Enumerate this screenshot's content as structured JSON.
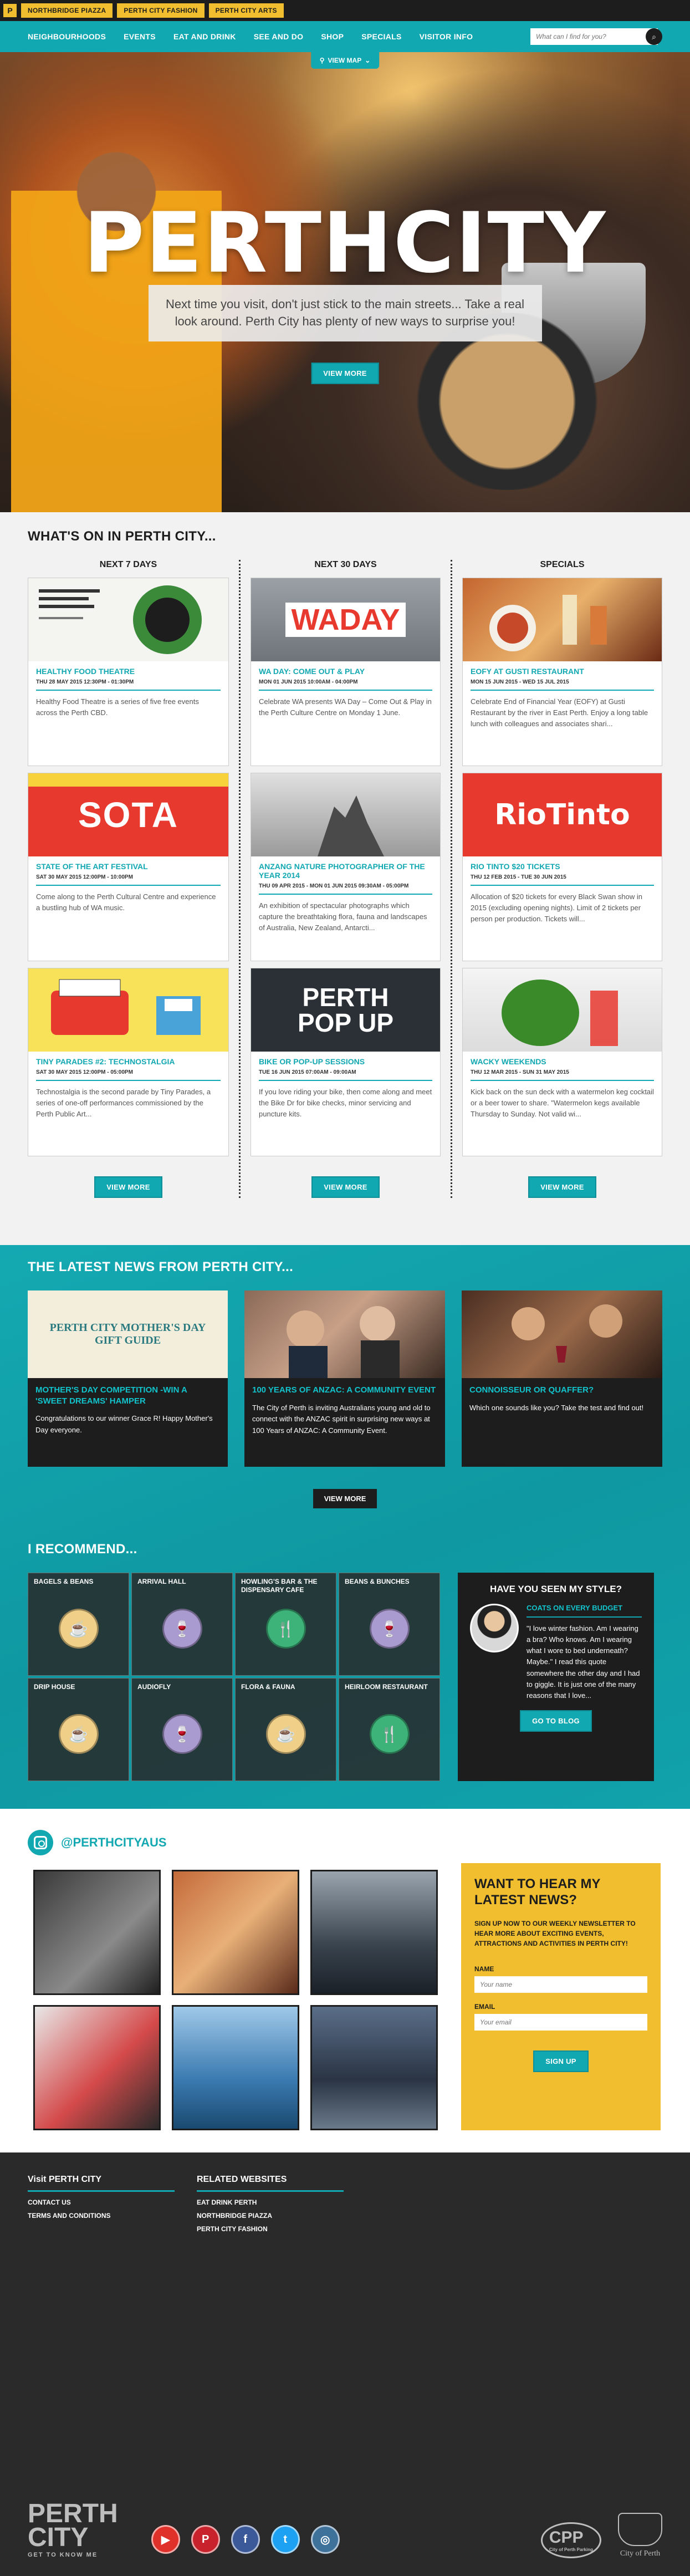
{
  "topbar": {
    "logo_letter": "P",
    "links": [
      "NORTHBRIDGE PIAZZA",
      "PERTH CITY FASHION",
      "PERTH CITY ARTS"
    ]
  },
  "nav": {
    "items": [
      "NEIGHBOURHOODS",
      "EVENTS",
      "EAT AND DRINK",
      "SEE AND DO",
      "SHOP",
      "SPECIALS",
      "VISITOR INFO"
    ],
    "search_placeholder": "What can I find for you?"
  },
  "hero": {
    "map_button": "VIEW MAP",
    "brand": "PERTHCITY",
    "tagline": "Next time you visit, don't just stick to the main streets... Take a real look around. Perth City has plenty of new ways to surprise you!",
    "view_more": "VIEW MORE"
  },
  "whats_on": {
    "title": "WHAT'S ON IN PERTH CITY...",
    "columns": [
      {
        "heading": "NEXT 7 DAYS",
        "cards": [
          {
            "title": "HEALTHY FOOD THEATRE",
            "date": "THU 28 MAY 2015 12:30PM - 01:30PM",
            "desc": "Healthy Food Theatre is a series of five free events across the Perth CBD.",
            "thumb_bg": "#f4f4f0",
            "thumb_label": ""
          },
          {
            "title": "STATE OF THE ART FESTIVAL",
            "date": "SAT 30 MAY 2015 12:00PM - 10:00PM",
            "desc": "Come along to the Perth Cultural Centre and experience a bustling hub of WA music.",
            "thumb_bg": "#e8392f",
            "thumb_label": "SOTA"
          },
          {
            "title": "TINY PARADES #2: TECHNOSTALGIA",
            "date": "SAT 30 MAY 2015 12:00PM - 05:00PM",
            "desc": "Technostalgia is the second parade by Tiny Parades, a series of one-off performances commissioned by the Perth Public Art...",
            "thumb_bg": "#f7e25a",
            "thumb_label": ""
          }
        ],
        "more": "VIEW MORE"
      },
      {
        "heading": "NEXT 30 DAYS",
        "cards": [
          {
            "title": "WA DAY: COME OUT & PLAY",
            "date": "MON 01 JUN 2015 10:00AM - 04:00PM",
            "desc": "Celebrate WA presents WA Day – Come Out & Play in the Perth Culture Centre on Monday 1 June.",
            "thumb_bg": "#8a8f95",
            "thumb_label": "WADAY"
          },
          {
            "title": "ANZANG NATURE PHOTOGRAPHER OF THE YEAR 2014",
            "date": "THU 09 APR 2015 - MON 01 JUN 2015 09:30AM - 05:00PM",
            "desc": "An exhibition of spectacular photographs which capture the breathtaking flora, fauna and landscapes of Australia, New Zealand, Antarcti...",
            "thumb_bg": "#c8c8c8",
            "thumb_label": ""
          },
          {
            "title": "BIKE OR POP-UP SESSIONS",
            "date": "TUE 16 JUN 2015 07:00AM - 09:00AM",
            "desc": "If you love riding your bike, then come along and meet the Bike Dr for bike checks, minor servicing and puncture kits.",
            "thumb_bg": "#2b2f36",
            "thumb_label": "PERTH POP UP"
          }
        ],
        "more": "VIEW MORE"
      },
      {
        "heading": "SPECIALS",
        "cards": [
          {
            "title": "EOFY AT GUSTI RESTAURANT",
            "date": "MON 15 JUN 2015 - WED 15 JUL 2015",
            "desc": "Celebrate End of Financial Year (EOFY) at Gusti Restaurant by the river in East Perth. Enjoy a long table lunch with colleagues and associates shari...",
            "thumb_bg": "#b45a2c",
            "thumb_label": ""
          },
          {
            "title": "RIO TINTO $20 TICKETS",
            "date": "THU 12 FEB 2015 - TUE 30 JUN 2015",
            "desc": "Allocation of $20 tickets for every Black Swan show in 2015 (excluding opening nights). Limit of 2 tickets per person per production. Tickets will...",
            "thumb_bg": "#e8392f",
            "thumb_label": "RioTinto"
          },
          {
            "title": "WACKY WEEKENDS",
            "date": "THU 12 MAR 2015 - SUN 31 MAY 2015",
            "desc": "Kick back on the sun deck with a watermelon keg cocktail or a beer tower to share. \"Watermelon kegs available Thursday to Sunday. Not valid wi...",
            "thumb_bg": "#6aa84f",
            "thumb_label": ""
          }
        ],
        "more": "VIEW MORE"
      }
    ]
  },
  "news": {
    "title": "THE LATEST NEWS FROM PERTH CITY...",
    "cards": [
      {
        "title": "MOTHER'S DAY COMPETITION -WIN A 'SWEET DREAMS' HAMPER",
        "desc": "Congratulations to our winner Grace R! Happy Mother's Day everyone.",
        "thumb_bg": "#f3eedc",
        "thumb_label": "PERTH CITY MOTHER'S DAY GIFT GUIDE"
      },
      {
        "title": "100 YEARS OF ANZAC: A COMMUNITY EVENT",
        "desc": "The City of Perth is inviting Australians young and old to connect with the ANZAC spirit in surprising new ways at 100 Years of ANZAC: A Community Event.",
        "thumb_bg": "#7a5a48",
        "thumb_label": ""
      },
      {
        "title": "CONNOISSEUR OR QUAFFER?",
        "desc": "Which one sounds like you? Take the test and find out!",
        "thumb_bg": "#5a3a2a",
        "thumb_label": ""
      }
    ],
    "more": "VIEW MORE"
  },
  "recommend": {
    "title": "I RECOMMEND...",
    "tiles": [
      {
        "name": "BAGELS & BEANS",
        "icon": "coffee-cup-icon",
        "color": "#f0d089",
        "glyph": "☕"
      },
      {
        "name": "ARRIVAL HALL",
        "icon": "wine-glass-icon",
        "color": "#a99ad0",
        "glyph": "🍷"
      },
      {
        "name": "HOWLING'S BAR & THE DISPENSARY CAFE",
        "icon": "cutlery-icon",
        "color": "#3db37a",
        "glyph": "🍴"
      },
      {
        "name": "BEANS & BUNCHES",
        "icon": "wine-glass-icon",
        "color": "#a99ad0",
        "glyph": "🍷"
      },
      {
        "name": "DRIP HOUSE",
        "icon": "coffee-cup-icon",
        "color": "#f0d089",
        "glyph": "☕"
      },
      {
        "name": "AUDIOFLY",
        "icon": "wine-glass-icon",
        "color": "#a99ad0",
        "glyph": "🍷"
      },
      {
        "name": "FLORA & FAUNA",
        "icon": "coffee-cup-icon",
        "color": "#f0d089",
        "glyph": "☕"
      },
      {
        "name": "HEIRLOOM RESTAURANT",
        "icon": "cutlery-icon",
        "color": "#3db37a",
        "glyph": "🍴"
      }
    ],
    "style": {
      "title": "HAVE YOU SEEN MY STYLE?",
      "link": "COATS ON EVERY BUDGET",
      "desc": "\"I love winter fashion. Am I wearing a bra? Who knows. Am I wearing what I wore to bed underneath? Maybe.\" I read this quote somewhere the other day and I had to giggle. It is just one of the many reasons that I love...",
      "button": "GO TO BLOG"
    }
  },
  "instagram": {
    "handle": "@PERTHCITYAUS",
    "photos": [
      {
        "bg": "linear-gradient(135deg,#3a3a3a,#8a8a8a 60%,#1f1f1f)"
      },
      {
        "bg": "linear-gradient(135deg,#c46a3a,#e8b078 50%,#5a2a1a)"
      },
      {
        "bg": "linear-gradient(180deg,#9aa4ae,#3a444e 60%,#1a2028)"
      },
      {
        "bg": "linear-gradient(135deg,#e8e8e8,#d44a4a 55%,#2a2a2a)"
      },
      {
        "bg": "linear-gradient(180deg,#9fc8e8,#3a7ab0 60%,#1a4a70)"
      },
      {
        "bg": "linear-gradient(180deg,#5a6e88,#2a3444 60%,#6a7a8a)"
      }
    ]
  },
  "newsletter": {
    "title": "WANT TO HEAR MY LATEST NEWS?",
    "sub": "SIGN UP NOW TO OUR WEEKLY NEWSLETTER TO HEAR MORE ABOUT EXCITING EVENTS, ATTRACTIONS AND ACTIVITIES IN PERTH CITY!",
    "name_label": "NAME",
    "name_placeholder": "Your name",
    "email_label": "EMAIL",
    "email_placeholder": "Your email",
    "button": "SIGN UP"
  },
  "footer": {
    "visit_heading": "Visit PERTH CITY",
    "visit_links": [
      "CONTACT US",
      "TERMS AND CONDITIONS"
    ],
    "related_heading": "RELATED WEBSITES",
    "related_links": [
      "EAT DRINK PERTH",
      "NORTHBRIDGE PIAZZA",
      "PERTH CITY FASHION"
    ],
    "logo_line1": "PERTH",
    "logo_line2": "CITY",
    "logo_tagline": "GET TO KNOW ME",
    "social": [
      {
        "name": "youtube-icon",
        "glyph": "▶",
        "color": "#e0302a"
      },
      {
        "name": "pinterest-icon",
        "glyph": "P",
        "color": "#c8232c"
      },
      {
        "name": "facebook-icon",
        "glyph": "f",
        "color": "#3b5998"
      },
      {
        "name": "twitter-icon",
        "glyph": "t",
        "color": "#1da1f2"
      },
      {
        "name": "instagram-icon",
        "glyph": "◎",
        "color": "#3f729b"
      }
    ],
    "cpp": "CPP",
    "cpp_sub": "City of Perth Parking",
    "cop": "City of Perth"
  }
}
